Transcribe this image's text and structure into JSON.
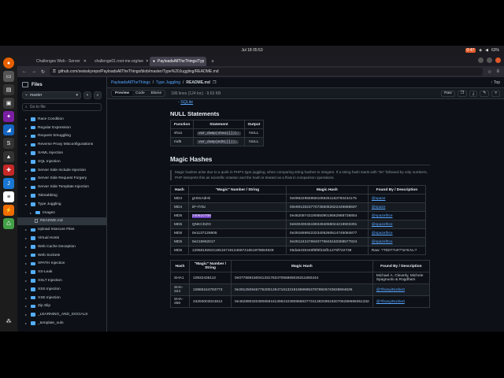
{
  "system": {
    "clock": "Jul 18 05:53",
    "battery": "0:47",
    "percent": "63%"
  },
  "tabs": [
    {
      "label": "Challenges Web - Server"
    },
    {
      "label": "challenge01.root-me.org/we"
    },
    {
      "label": "PayloadsAllTheThings/Typ"
    }
  ],
  "url": "github.com/swisskyrepo/PayloadsAllTheThings/blob/master/Type%20Juggling/README.md",
  "sidebar": {
    "title": "Files",
    "branch": "master",
    "goto_placeholder": "Go to file",
    "items": [
      {
        "label": "Race Condition",
        "level": 0
      },
      {
        "label": "Regular Expression",
        "level": 0
      },
      {
        "label": "Request Smuggling",
        "level": 0
      },
      {
        "label": "Reverse Proxy Misconfigurations",
        "level": 0
      },
      {
        "label": "SAML Injection",
        "level": 0
      },
      {
        "label": "SQL Injection",
        "level": 0
      },
      {
        "label": "Server Side Include Injection",
        "level": 0
      },
      {
        "label": "Server Side Request Forgery",
        "level": 0
      },
      {
        "label": "Server Side Template Injection",
        "level": 0
      },
      {
        "label": "Tabnabbing",
        "level": 0
      },
      {
        "label": "Type Juggling",
        "level": 0,
        "open": true
      },
      {
        "label": "Images",
        "level": 1
      },
      {
        "label": "README.md",
        "level": 2,
        "file": true,
        "selected": true
      },
      {
        "label": "Upload Insecure Files",
        "level": 0
      },
      {
        "label": "Virtual Hosts",
        "level": 0
      },
      {
        "label": "Web Cache Deception",
        "level": 0
      },
      {
        "label": "Web Sockets",
        "level": 0
      },
      {
        "label": "XPATH Injection",
        "level": 0
      },
      {
        "label": "XS-Leak",
        "level": 0
      },
      {
        "label": "XSLT Injection",
        "level": 0
      },
      {
        "label": "XSS Injection",
        "level": 0
      },
      {
        "label": "XXE Injection",
        "level": 0
      },
      {
        "label": "Zip Slip",
        "level": 0
      },
      {
        "label": "_LEARNING_AND_SOCIALS",
        "level": 0
      },
      {
        "label": "_template_vuln",
        "level": 0
      }
    ]
  },
  "breadcrumb": {
    "repo": "PayloadsAllTheThings",
    "sep": "/",
    "folder": "Type Juggling",
    "file": "README.md",
    "top": "Top"
  },
  "filebar": {
    "preview": "Preview",
    "code": "Code",
    "blame": "Blame",
    "info": "186 lines (124 loc) · 9.63 KB",
    "raw": "Raw"
  },
  "doc": {
    "bullet": "SQLite",
    "null_title": "NULL Statements",
    "null_headers": [
      "Function",
      "Statement",
      "Output"
    ],
    "null_rows": [
      [
        "sha1",
        "var_dump(sha1([]));",
        "NULL"
      ],
      [
        "md5",
        "var_dump(md5([]));",
        "NULL"
      ]
    ],
    "magic_title": "Magic Hashes",
    "magic_quote": "Magic hashes arise due to a quirk in PHP's type juggling, when comparing string hashes to integers. If a string hash starts with \"0e\" followed by only numbers, PHP interprets this as scientific notation and the hash is treated as a float in comparison operations.",
    "magic_headers": [
      "Hash",
      "\"Magic\" Number / String",
      "Magic Hash",
      "Found By / Description"
    ],
    "magic_rows": [
      [
        "MD4",
        "gH0nAdHk",
        "0e096229559581069251163783434175",
        "@spaze"
      ],
      [
        "MD4",
        "IiF+hTai",
        "00e90130237707355082822449868597",
        "@spaze"
      ],
      [
        "MD5",
        "240610708",
        "0e462097431906509019562988736854",
        "@spazef0ce"
      ],
      [
        "MD5",
        "QNKCDZO",
        "0e830400451993494058024219903391",
        "@spazef0ce"
      ],
      [
        "MD5",
        "0e1137126905",
        "0e291659922323405260514745084877",
        "@spazef0ce"
      ],
      [
        "MD5",
        "0e215962017",
        "0e291242476940776845150308577824",
        "@spazef0ce"
      ],
      [
        "MD5",
        "129581926211651571912466741651878684928",
        "06da5430449f8f6f23dfc1276f722738",
        "Raw: ?T0D??o#??a*8.N=?"
      ]
    ],
    "sha_headers": [
      "Hash",
      "\"Magic\" Number / String",
      "Magic Hash",
      "Found By / Description"
    ],
    "sha_rows": [
      [
        "SHA1",
        "10932435112",
        "0e07766915004133176347055865026311692244",
        "Michael A. Cleverly, Michele Spagnuolo & Rogdham"
      ],
      [
        "SHA-224",
        "10885164793773",
        "0e281250946775200129471613219196999537878926740638594636",
        "@TihanyiNorbert"
      ],
      [
        "SHA-256",
        "34250003024812",
        "0e46289032038065916139621039085883773413820991920706299695051332",
        "@TihanyiNorbert"
      ]
    ]
  }
}
